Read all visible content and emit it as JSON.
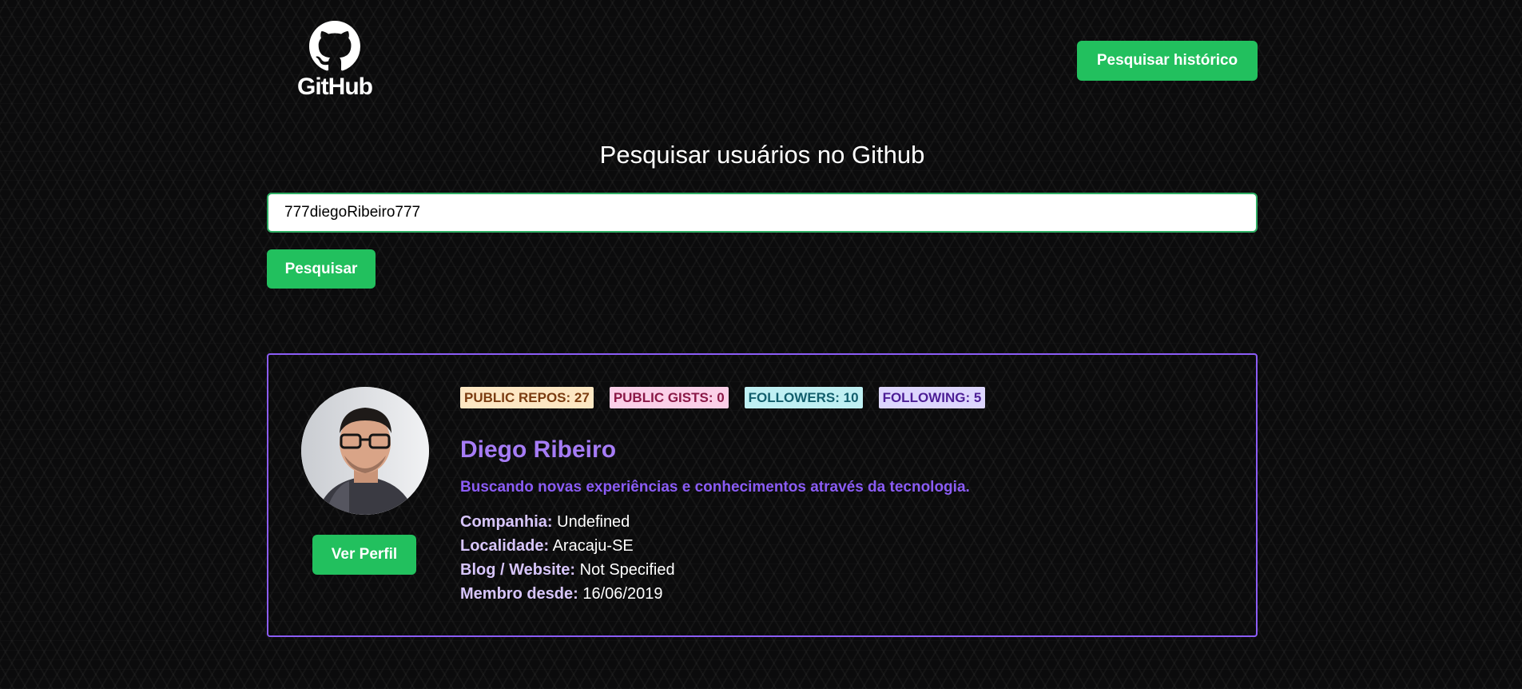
{
  "header": {
    "logo_text": "GitHub",
    "history_button": "Pesquisar histórico"
  },
  "search": {
    "title": "Pesquisar usuários no Github",
    "value": "777diegoRibeiro777",
    "button": "Pesquisar"
  },
  "profile": {
    "badges": {
      "repos": "PUBLIC REPOS: 27",
      "gists": "PUBLIC GISTS: 0",
      "followers": "FOLLOWERS: 10",
      "following": "FOLLOWING: 5"
    },
    "name": "Diego Ribeiro",
    "bio": "Buscando novas experiências e conhecimentos através da tecnologia.",
    "view_profile_button": "Ver Perfil",
    "info": [
      {
        "label": "Companhia:",
        "value": "Undefined"
      },
      {
        "label": "Localidade:",
        "value": "Aracaju-SE"
      },
      {
        "label": "Blog / Website:",
        "value": "Not Specified"
      },
      {
        "label": "Membro desde:",
        "value": "16/06/2019"
      }
    ]
  },
  "colors": {
    "accent_green": "#22c05e",
    "accent_purple": "#8b5cf6",
    "background": "#0b0b0c"
  },
  "icons": {
    "logo": "github-octocat-icon",
    "avatar": "user-avatar-photo"
  }
}
